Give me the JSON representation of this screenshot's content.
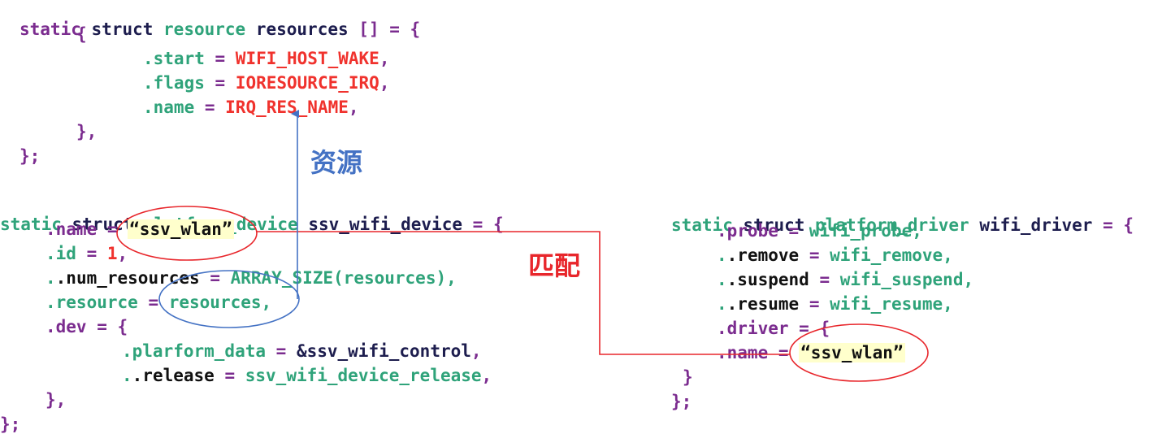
{
  "resources_block": {
    "l1": {
      "static": "static",
      "struct": "struct",
      "type": "resource",
      "name": "resources",
      "rest": "[] = {"
    },
    "l2": "{",
    "l3": {
      "field": ".start",
      "eq": " = ",
      "val": "WIFI_HOST_WAKE",
      "comma": ","
    },
    "l4": {
      "field": ".flags",
      "eq": " = ",
      "val": "IORESOURCE_IRQ",
      "comma": ","
    },
    "l5": {
      "field": ".name",
      "eq": " = ",
      "val": "IRQ_RES_NAME",
      "comma": ","
    },
    "l6": "},",
    "l7": "};"
  },
  "device_block": {
    "l1": {
      "static": "static",
      "struct": "struct",
      "type": "platform_device",
      "name": "ssv_wifi_device",
      "rest": "= {"
    },
    "l2": {
      "field": ".name",
      "eq": " = ",
      "val": "“ssv_wlan”"
    },
    "l3": {
      "field": ".id",
      "eq": " = ",
      "val": "1",
      "comma": ","
    },
    "l4": {
      "field": ".num_resources",
      "eq": " = ",
      "val": "ARRAY_SIZE(resources),"
    },
    "l5": {
      "field": ".resource",
      "eq": " = ",
      "val": "resources,"
    },
    "l6": {
      "field": ".dev",
      "eq": " = ",
      "rest": "{"
    },
    "l7": {
      "field": ".plarform_data",
      "eq": " = ",
      "val": "&ssv_wifi_control",
      "comma": ","
    },
    "l8": {
      "field": ".release",
      "eq": " = ",
      "val": "ssv_wifi_device_release",
      "comma": ","
    },
    "l9": "},",
    "l10": "};"
  },
  "driver_block": {
    "l1": {
      "static": "static",
      "struct": "struct",
      "type": "platform_driver",
      "name": "wifi_driver",
      "rest": "= {"
    },
    "l2": {
      "field": ".probe",
      "eq": " = ",
      "val": "wifi_probe,"
    },
    "l3": {
      "field": ".remove",
      "eq": " = ",
      "val": "wifi_remove,"
    },
    "l4": {
      "field": ".suspend",
      "eq": " = ",
      "val": "wifi_suspend,"
    },
    "l5": {
      "field": ".resume",
      "eq": " = ",
      "val": "wifi_resume,"
    },
    "l6": {
      "field": ".driver",
      "eq": " = ",
      "rest": "{"
    },
    "l7": {
      "field": ".name",
      "eq": " = ",
      "val": "“ssv_wlan”"
    },
    "l8": "}",
    "l9": "};"
  },
  "annotations": {
    "resource_label": "资源",
    "match_label": "匹配",
    "resource_color": "#4472C4",
    "match_color": "#E8262B"
  }
}
